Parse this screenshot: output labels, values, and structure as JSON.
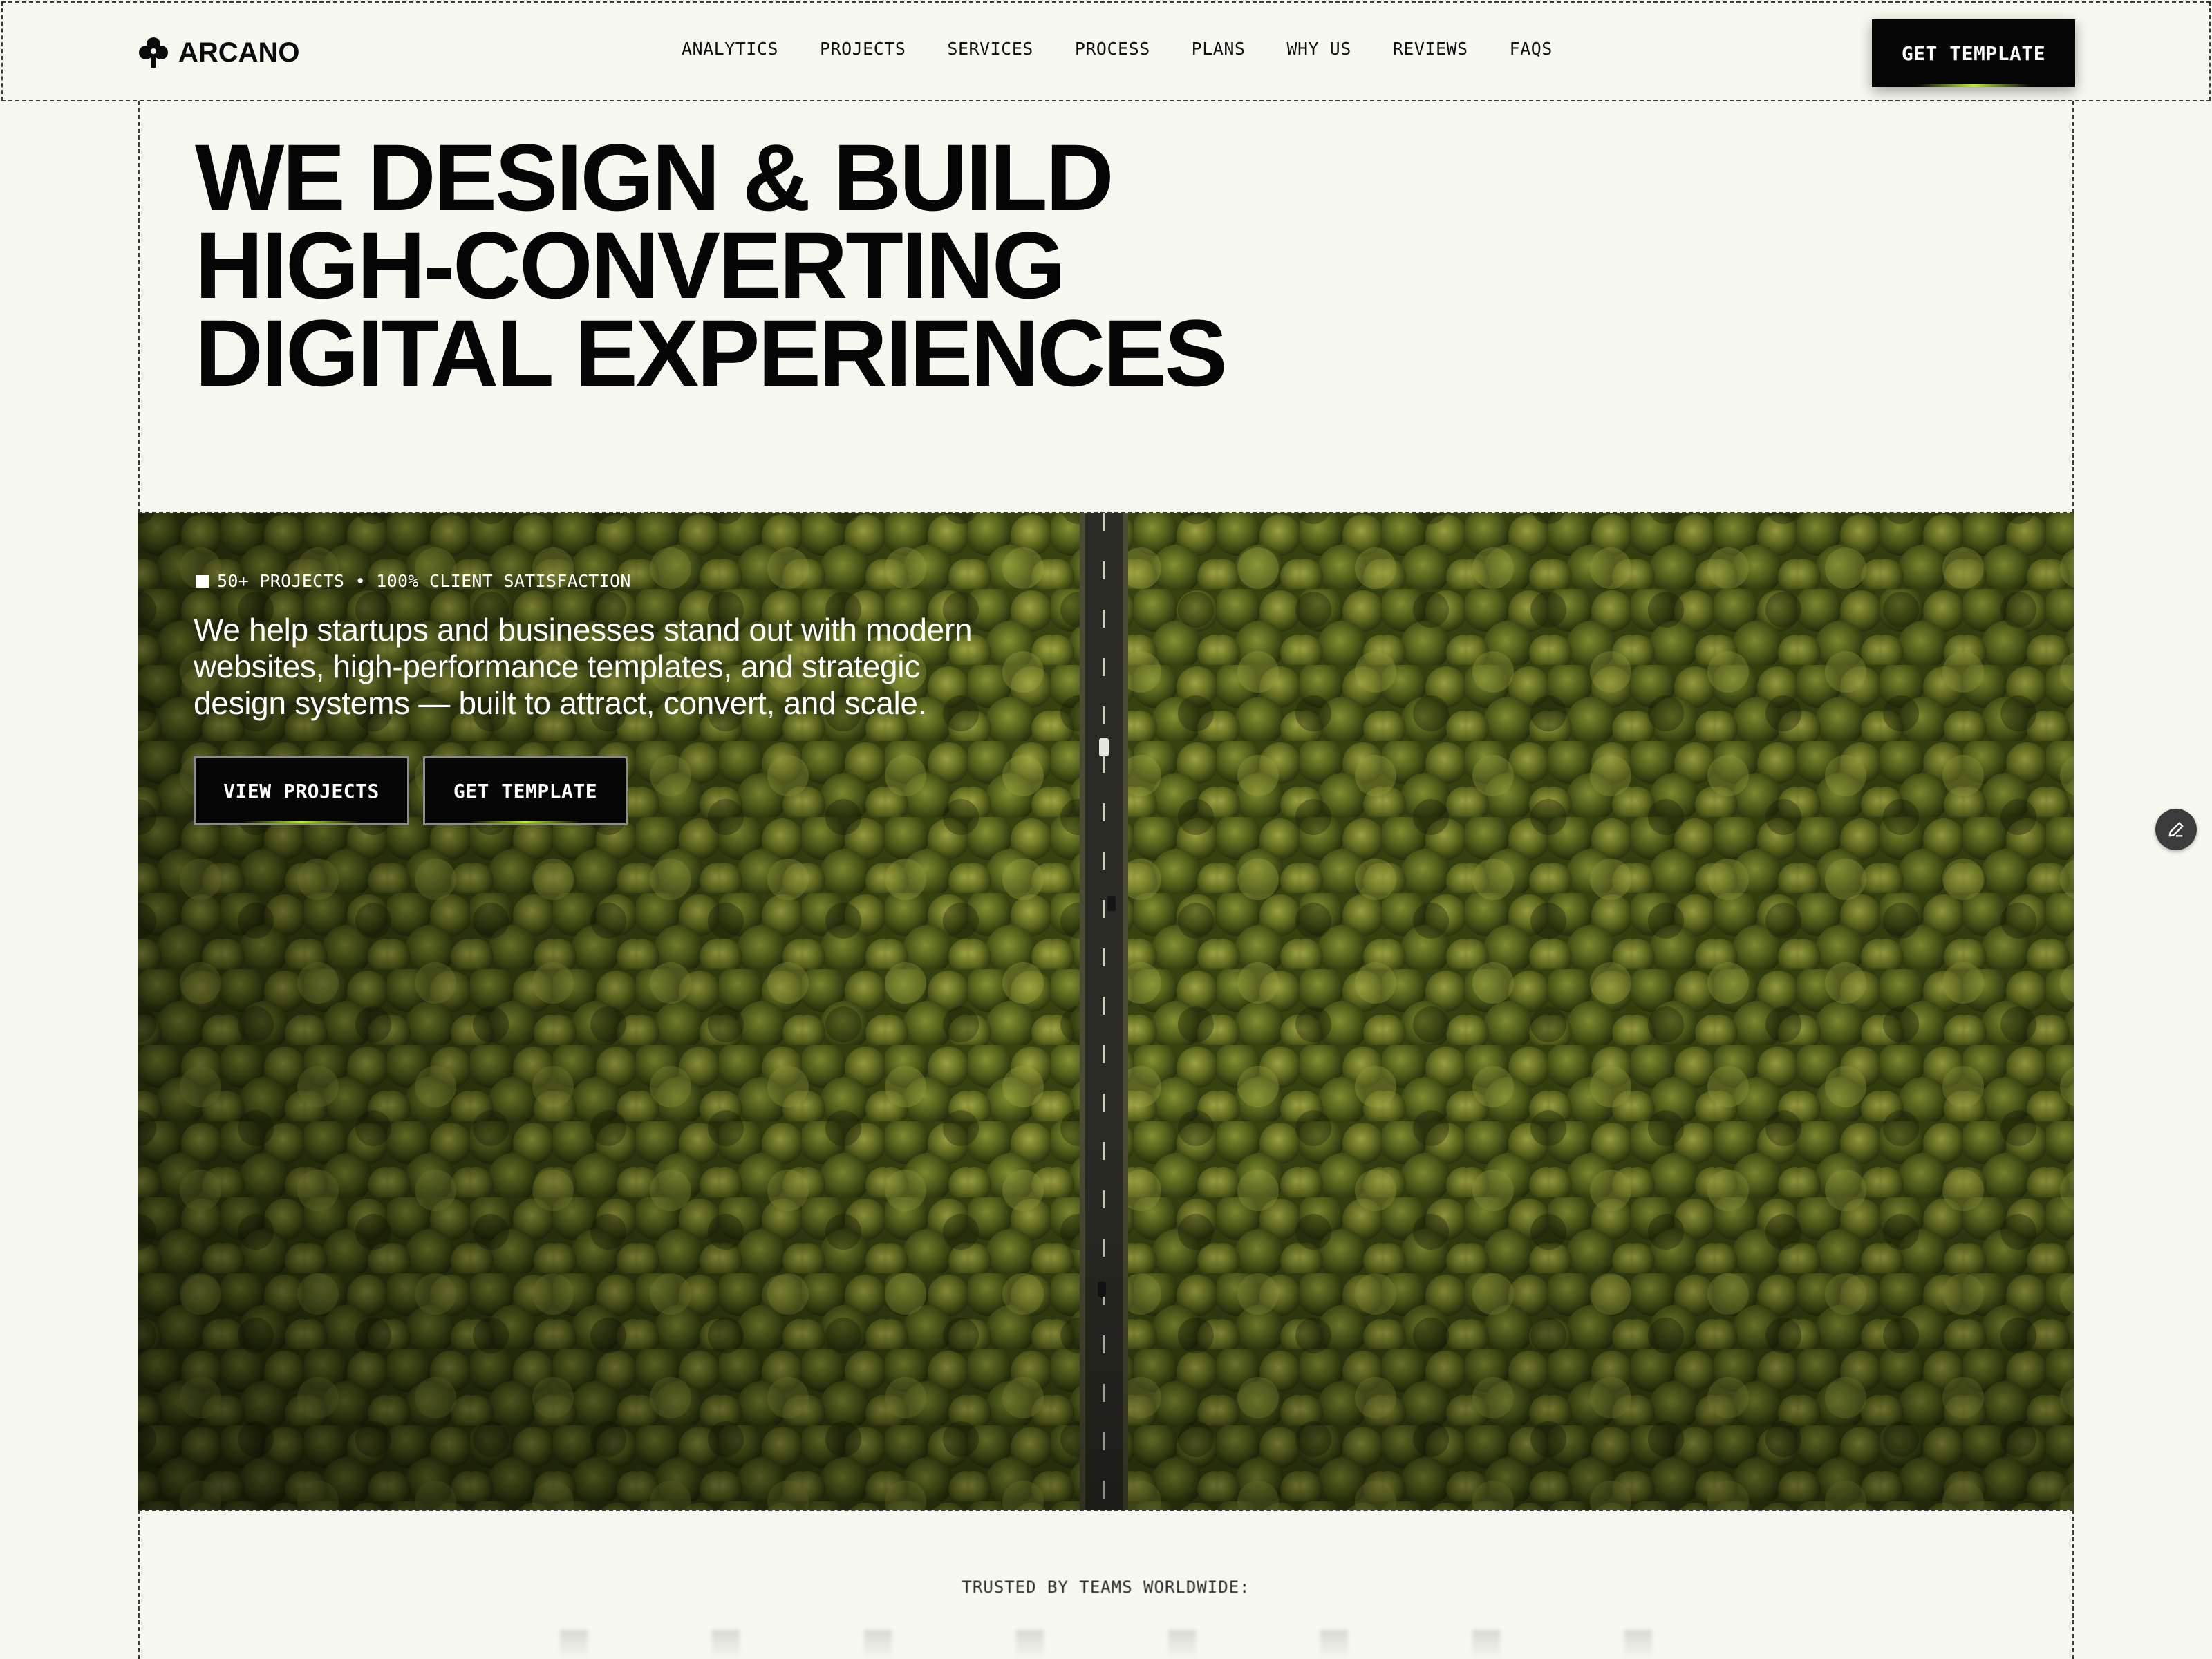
{
  "brand": {
    "name": "ARCANO",
    "logo_icon": "flower-icon"
  },
  "header": {
    "nav": [
      "ANALYTICS",
      "PROJECTS",
      "SERVICES",
      "PROCESS",
      "PLANS",
      "WHY US",
      "REVIEWS",
      "FAQS"
    ],
    "cta_label": "GET TEMPLATE"
  },
  "hero": {
    "headline": [
      "WE DESIGN & BUILD",
      "HIGH-CONVERTING",
      "DIGITAL EXPERIENCES"
    ],
    "stats": "50+ PROJECTS • 100% CLIENT SATISFACTION",
    "lead": [
      "We help startups and businesses stand out with modern",
      "websites, high-performance templates, and strategic",
      "design systems — built to attract, convert, and scale."
    ],
    "primary_button": "VIEW PROJECTS",
    "secondary_button": "GET TEMPLATE",
    "image_subject": "aerial view of pine forest with a road"
  },
  "trusted": {
    "label": "TRUSTED BY TEAMS WORLDWIDE:"
  },
  "edit_button_icon": "pencil-icon",
  "colors": {
    "background": "#f7f8ef",
    "button": "#050505",
    "accent_glow": "#b9f02c"
  }
}
